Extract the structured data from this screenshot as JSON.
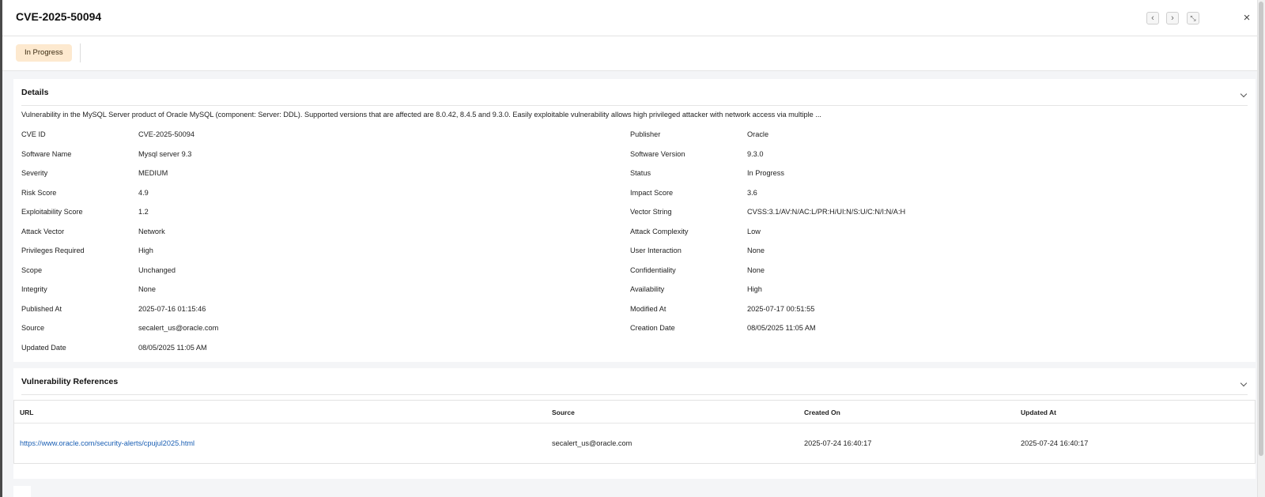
{
  "header": {
    "title": "CVE-2025-50094",
    "prev_glyph": "‹",
    "next_glyph": "›",
    "collapse_glyph": "⤡",
    "close_glyph": "×"
  },
  "status": {
    "label": "In Progress"
  },
  "details": {
    "title": "Details",
    "description": "Vulnerability in the MySQL Server product of Oracle MySQL (component: Server: DDL). Supported versions that are affected are 8.0.42, 8.4.5 and 9.3.0. Easily exploitable vulnerability allows high privileged attacker with network access via multiple ...",
    "left_fields": [
      {
        "label": "CVE ID",
        "value": "CVE-2025-50094"
      },
      {
        "label": "Software Name",
        "value": "Mysql server 9.3"
      },
      {
        "label": "Severity",
        "value": "MEDIUM"
      },
      {
        "label": "Risk Score",
        "value": "4.9"
      },
      {
        "label": "Exploitability Score",
        "value": "1.2"
      },
      {
        "label": "Attack Vector",
        "value": "Network"
      },
      {
        "label": "Privileges Required",
        "value": "High"
      },
      {
        "label": "Scope",
        "value": "Unchanged"
      },
      {
        "label": "Integrity",
        "value": "None"
      },
      {
        "label": "Published At",
        "value": "2025-07-16 01:15:46"
      },
      {
        "label": "Source",
        "value": "secalert_us@oracle.com"
      },
      {
        "label": "Updated Date",
        "value": "08/05/2025 11:05 AM"
      }
    ],
    "right_fields": [
      {
        "label": "Publisher",
        "value": "Oracle"
      },
      {
        "label": "Software Version",
        "value": "9.3.0"
      },
      {
        "label": "Status",
        "value": "In Progress"
      },
      {
        "label": "Impact Score",
        "value": "3.6"
      },
      {
        "label": "Vector String",
        "value": "CVSS:3.1/AV:N/AC:L/PR:H/UI:N/S:U/C:N/I:N/A:H"
      },
      {
        "label": "Attack Complexity",
        "value": "Low"
      },
      {
        "label": "User Interaction",
        "value": "None"
      },
      {
        "label": "Confidentiality",
        "value": "None"
      },
      {
        "label": "Availability",
        "value": "High"
      },
      {
        "label": "Modified At",
        "value": "2025-07-17 00:51:55"
      },
      {
        "label": "Creation Date",
        "value": "08/05/2025 11:05 AM"
      }
    ]
  },
  "references": {
    "title": "Vulnerability References",
    "columns": [
      "URL",
      "Source",
      "Created On",
      "Updated At"
    ],
    "rows": [
      {
        "url": "https://www.oracle.com/security-alerts/cpujul2025.html",
        "source": "secalert_us@oracle.com",
        "created_on": "2025-07-24 16:40:17",
        "updated_at": "2025-07-24 16:40:17"
      }
    ]
  },
  "colors": {
    "status_pill_bg": "#fde9cf",
    "link": "#1a5fb4",
    "page_bg": "#f4f5f7"
  }
}
